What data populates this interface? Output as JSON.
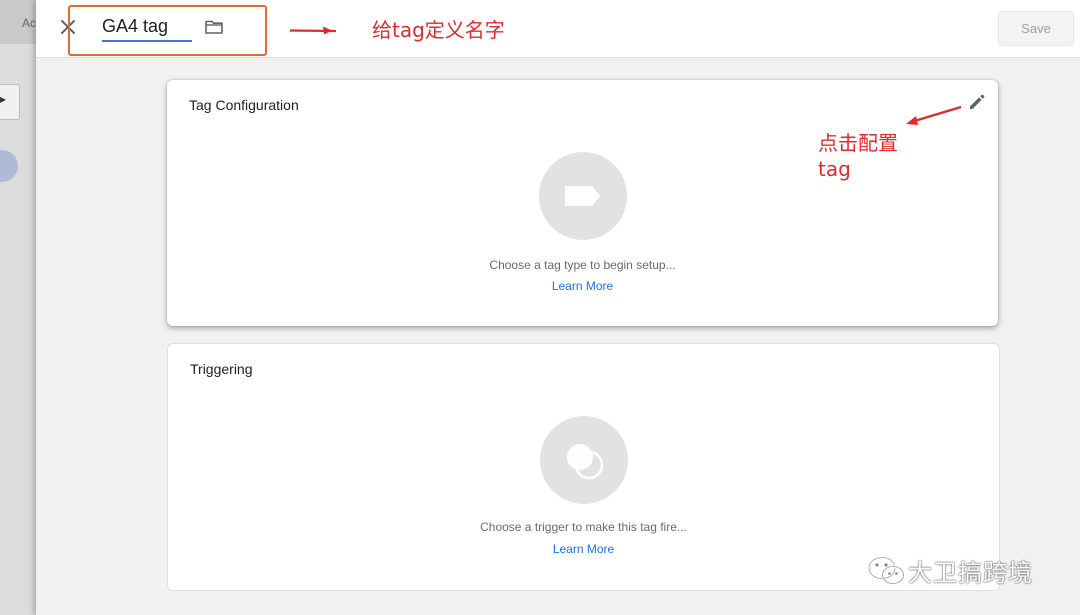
{
  "background": {
    "tab_fragment": "Ac",
    "button_glyph": "▸"
  },
  "header": {
    "tag_name": "GA4 tag",
    "save_label": "Save",
    "close_icon": "close-icon",
    "folder_icon": "folder-icon"
  },
  "tag_configuration": {
    "title": "Tag Configuration",
    "hint": "Choose a tag type to begin setup...",
    "learn_more": "Learn More",
    "icon": "tag-icon",
    "edit_icon": "pencil-icon"
  },
  "triggering": {
    "title": "Triggering",
    "hint": "Choose a trigger to make this tag fire...",
    "learn_more": "Learn More",
    "icon": "trigger-circles-icon"
  },
  "annotations": {
    "name_note": "给tag定义名字",
    "config_note_line1": "点击配置",
    "config_note_line2": "tag",
    "watermark": "大卫搞跨境"
  },
  "colors": {
    "accent_link": "#1a73e8",
    "annotation_red": "#e02b2b",
    "annotation_box": "#e26a2c",
    "name_underline": "#4a6fd6"
  }
}
